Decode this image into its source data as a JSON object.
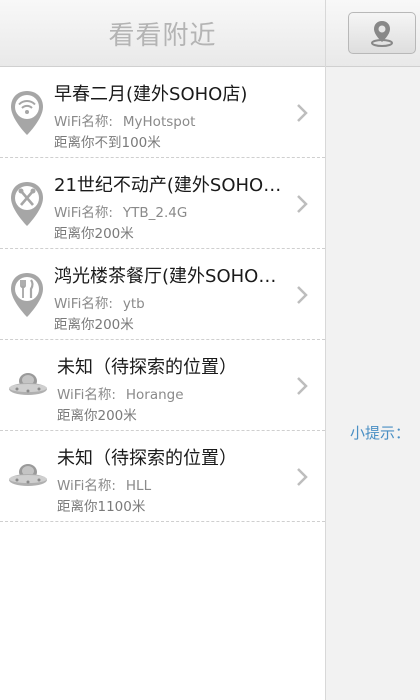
{
  "header": {
    "title": "看看附近"
  },
  "right_panel": {
    "tip": "小提示："
  },
  "list": {
    "items": [
      {
        "title": "早春二月(建外SOHO店)",
        "wifi_label": "WiFi名称:",
        "wifi_name": "MyHotspot",
        "distance": "距离你不到100米",
        "icon": "wifi-pin-icon"
      },
      {
        "title": "21世纪不动产(建外SOHO…",
        "wifi_label": "WiFi名称:",
        "wifi_name": "YTB_2.4G",
        "distance": "距离你200米",
        "icon": "tools-pin-icon"
      },
      {
        "title": "鸿光楼茶餐厅(建外SOHO…",
        "wifi_label": "WiFi名称:",
        "wifi_name": "ytb",
        "distance": "距离你200米",
        "icon": "restaurant-pin-icon"
      },
      {
        "title": "未知（待探索的位置）",
        "wifi_label": "WiFi名称:",
        "wifi_name": "Horange",
        "distance": "距离你200米",
        "icon": "ufo-icon"
      },
      {
        "title": "未知（待探索的位置）",
        "wifi_label": "WiFi名称:",
        "wifi_name": "HLL",
        "distance": "距离你1100米",
        "icon": "ufo-icon"
      }
    ]
  },
  "colors": {
    "accent_tip": "#4a8fc4",
    "icon_gray": "#a6a6a6"
  }
}
